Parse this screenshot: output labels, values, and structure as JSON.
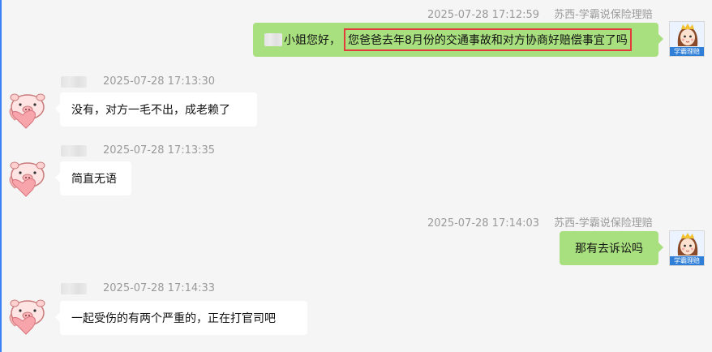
{
  "chat": {
    "messages": [
      {
        "direction": "out",
        "timestamp": "2025-07-28 17:12:59",
        "sender": "苏西-学霸说保险理赔",
        "text_prefix": "小姐您好，",
        "text_highlight": "您爸爸去年8月份的交通事故和对方协商好赔偿事宜了吗"
      },
      {
        "direction": "in",
        "timestamp": "2025-07-28 17:13:30",
        "text": "没有，对方一毛不出，成老赖了"
      },
      {
        "direction": "in",
        "timestamp": "2025-07-28 17:13:35",
        "text": "简直无语"
      },
      {
        "direction": "out",
        "timestamp": "2025-07-28 17:14:03",
        "sender": "苏西-学霸说保险理赔",
        "text": "那有去诉讼吗"
      },
      {
        "direction": "in",
        "timestamp": "2025-07-28 17:14:33",
        "text": "一起受伤的有两个严重的，正在打官司吧"
      }
    ],
    "agent_avatar_label": "学霸理赔",
    "colors": {
      "outgoing_bubble": "#a9e07f",
      "incoming_bubble": "#ffffff",
      "highlight_border": "#e23b3b",
      "background": "#f5f5f5"
    }
  }
}
